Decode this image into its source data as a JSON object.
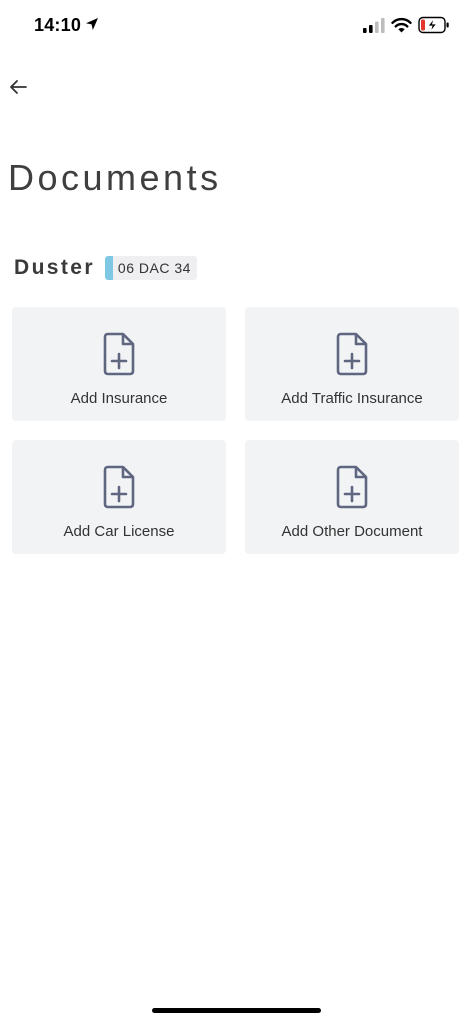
{
  "status_bar": {
    "time": "14:10"
  },
  "header": {
    "title": "Documents"
  },
  "vehicle": {
    "name": "Duster",
    "plate": "06 DAC 34",
    "plate_color": "#7ec8e3"
  },
  "cards": [
    {
      "label": "Add Insurance",
      "icon": "file-plus-icon"
    },
    {
      "label": "Add Traffic Insurance",
      "icon": "file-plus-icon"
    },
    {
      "label": "Add Car License",
      "icon": "file-plus-icon"
    },
    {
      "label": "Add Other Document",
      "icon": "file-plus-icon"
    }
  ],
  "colors": {
    "card_background": "#f2f3f5",
    "icon_color": "#5f6680"
  }
}
